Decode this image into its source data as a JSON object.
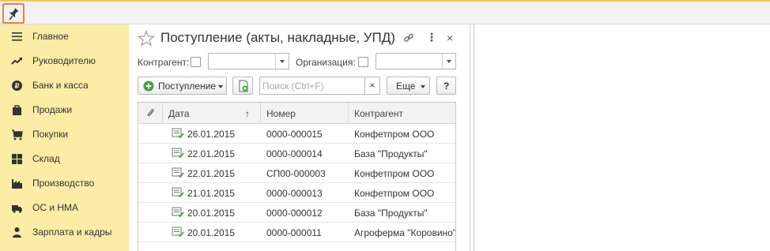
{
  "sidebar": {
    "items": [
      {
        "label": "Главное",
        "icon": "menu-lines-icon"
      },
      {
        "label": "Руководителю",
        "icon": "trend-up-icon"
      },
      {
        "label": "Банк и касса",
        "icon": "coin-icon"
      },
      {
        "label": "Продажи",
        "icon": "shopping-bag-icon"
      },
      {
        "label": "Покупки",
        "icon": "shopping-cart-icon"
      },
      {
        "label": "Склад",
        "icon": "warehouse-grid-icon"
      },
      {
        "label": "Производство",
        "icon": "factory-icon"
      },
      {
        "label": "ОС и НМА",
        "icon": "truck-icon"
      },
      {
        "label": "Зарплата и кадры",
        "icon": "person-icon"
      }
    ]
  },
  "form": {
    "title": "Поступление (акты, накладные, УПД)",
    "filters": {
      "counterparty_label": "Контрагент:",
      "organization_label": "Организация:"
    },
    "toolbar": {
      "create_label": "Поступление",
      "search_placeholder": "Поиск (Ctrl+F)",
      "clear_label": "×",
      "more_label": "Еще",
      "help_label": "?"
    },
    "table": {
      "columns": [
        "Дата",
        "Номер",
        "Контрагент"
      ],
      "sort_indicator": "↑",
      "rows": [
        {
          "date": "26.01.2015",
          "number": "0000-000015",
          "counterparty": "Конфетпром ООО"
        },
        {
          "date": "22.01.2015",
          "number": "0000-000014",
          "counterparty": "База \"Продукты\""
        },
        {
          "date": "22.01.2015",
          "number": "СП00-000003",
          "counterparty": "Конфетпром ООО"
        },
        {
          "date": "21.01.2015",
          "number": "0000-000013",
          "counterparty": "Конфетпром ООО"
        },
        {
          "date": "20.01.2015",
          "number": "0000-000012",
          "counterparty": "База \"Продукты\""
        },
        {
          "date": "20.01.2015",
          "number": "0000-000011",
          "counterparty": "Агроферма \"Коровино\""
        }
      ]
    }
  },
  "colors": {
    "sidebar_bg": "#fbeca6",
    "accent_orange": "#e8823a",
    "create_green": "#3fa33a"
  }
}
